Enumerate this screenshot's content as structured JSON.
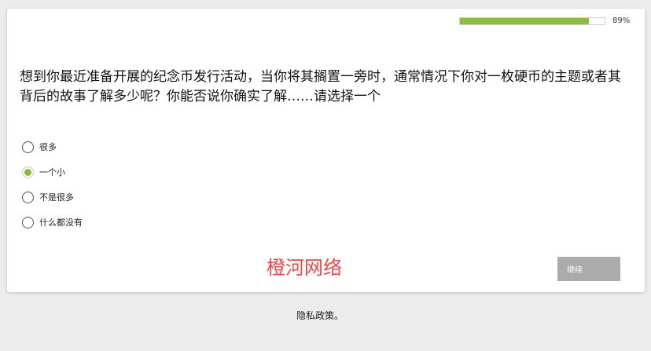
{
  "progress": {
    "percent": 89,
    "label": "89%"
  },
  "question": {
    "text": "想到你最近准备开展的纪念币发行活动，当你将其搁置一旁时，通常情况下你对一枚硬币的主题或者其背后的故事了解多少呢？你能否说你确实了解……请选择一个"
  },
  "options": [
    {
      "label": "很多",
      "selected": false
    },
    {
      "label": "一个小",
      "selected": true
    },
    {
      "label": "不是很多",
      "selected": false
    },
    {
      "label": "什么都没有",
      "selected": false
    }
  ],
  "watermark": "橙河网络",
  "buttons": {
    "continue_label": "继续"
  },
  "footer": {
    "privacy_label": "隐私政策。"
  },
  "colors": {
    "accent": "#8dbb3e",
    "watermark": "#e8474c",
    "button": "#ababab"
  }
}
